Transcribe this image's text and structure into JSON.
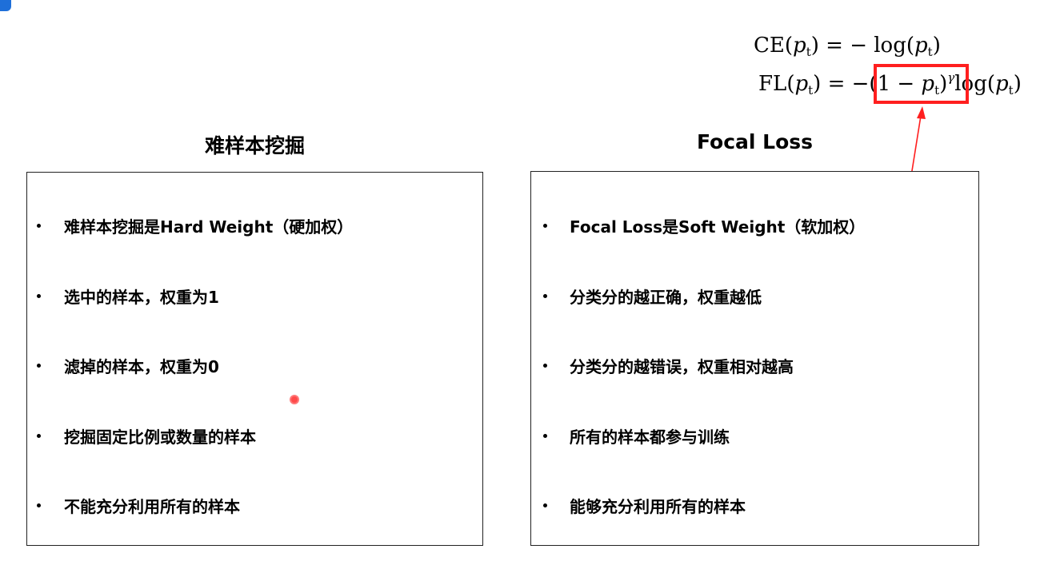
{
  "formulas": {
    "ce": {
      "lhs_name": "CE",
      "arg_var": "p",
      "arg_sub": "t",
      "equals_minus": " = − log(",
      "close": ")"
    },
    "fl": {
      "lhs_name": "FL",
      "arg_var": "p",
      "arg_sub": "t",
      "equals_minus": " = −",
      "mod_open": "(1 − ",
      "mod_close": ")",
      "gamma": "γ",
      "log_open": "log(",
      "close": ")"
    }
  },
  "left_panel": {
    "title": "难样本挖掘",
    "items": [
      "难样本挖掘是Hard Weight（硬加权）",
      "选中的样本，权重为1",
      "滤掉的样本，权重为0",
      "挖掘固定比例或数量的样本",
      "不能充分利用所有的样本"
    ]
  },
  "right_panel": {
    "title": "Focal Loss",
    "items": [
      "Focal Loss是Soft Weight（软加权）",
      "分类分的越正确，权重越低",
      "分类分的越错误，权重相对越高",
      "所有的样本都参与训练",
      "能够充分利用所有的样本"
    ]
  },
  "colors": {
    "highlight": "#ff1f1f",
    "corner_badge": "#1e6fd9"
  }
}
